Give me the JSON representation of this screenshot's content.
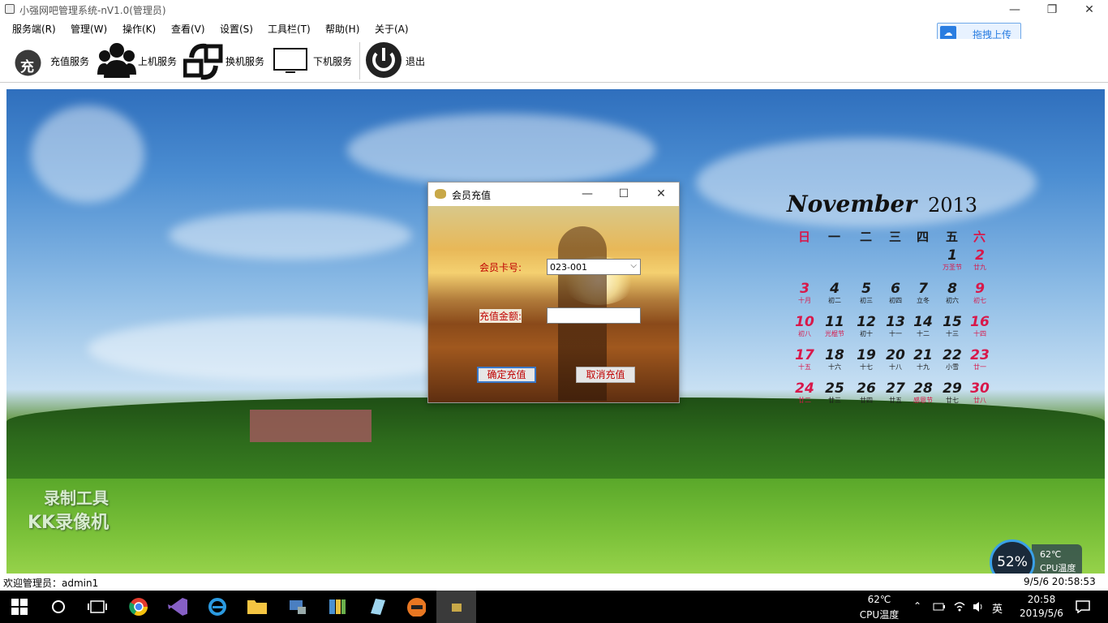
{
  "window": {
    "title": "小强网吧管理系统-nV1.0(管理员)"
  },
  "menu": [
    {
      "label": "服务端(R)"
    },
    {
      "label": "管理(W)"
    },
    {
      "label": "操作(K)"
    },
    {
      "label": "查看(V)"
    },
    {
      "label": "设置(S)"
    },
    {
      "label": "工具栏(T)"
    },
    {
      "label": "帮助(H)"
    },
    {
      "label": "关于(A)"
    }
  ],
  "upload": {
    "label": "拖拽上传"
  },
  "toolbar": {
    "recharge": {
      "label": "充值服务",
      "icon_text": "充"
    },
    "login": {
      "label": "上机服务"
    },
    "switch": {
      "label": "换机服务"
    },
    "logout": {
      "label": "下机服务"
    },
    "exit": {
      "label": "退出"
    }
  },
  "watermark": {
    "line1": "录制工具",
    "line2": "KK录像机"
  },
  "calendar": {
    "month": "November",
    "year": "2013",
    "weekdays": [
      "日",
      "一",
      "二",
      "三",
      "四",
      "五",
      "六"
    ],
    "days": [
      {
        "n": "1",
        "l": "万圣节",
        "col": 5,
        "row": 0
      },
      {
        "n": "2",
        "l": "廿九",
        "col": 6,
        "row": 0
      },
      {
        "n": "3",
        "l": "十月",
        "col": 0,
        "row": 1
      },
      {
        "n": "4",
        "l": "初二",
        "col": 1,
        "row": 1
      },
      {
        "n": "5",
        "l": "初三",
        "col": 2,
        "row": 1
      },
      {
        "n": "6",
        "l": "初四",
        "col": 3,
        "row": 1
      },
      {
        "n": "7",
        "l": "立冬",
        "col": 4,
        "row": 1
      },
      {
        "n": "8",
        "l": "初六",
        "col": 5,
        "row": 1
      },
      {
        "n": "9",
        "l": "初七",
        "col": 6,
        "row": 1
      },
      {
        "n": "10",
        "l": "初八",
        "col": 0,
        "row": 2
      },
      {
        "n": "11",
        "l": "光棍节",
        "col": 1,
        "row": 2
      },
      {
        "n": "12",
        "l": "初十",
        "col": 2,
        "row": 2
      },
      {
        "n": "13",
        "l": "十一",
        "col": 3,
        "row": 2
      },
      {
        "n": "14",
        "l": "十二",
        "col": 4,
        "row": 2
      },
      {
        "n": "15",
        "l": "十三",
        "col": 5,
        "row": 2
      },
      {
        "n": "16",
        "l": "十四",
        "col": 6,
        "row": 2
      },
      {
        "n": "17",
        "l": "十五",
        "col": 0,
        "row": 3
      },
      {
        "n": "18",
        "l": "十六",
        "col": 1,
        "row": 3
      },
      {
        "n": "19",
        "l": "十七",
        "col": 2,
        "row": 3
      },
      {
        "n": "20",
        "l": "十八",
        "col": 3,
        "row": 3
      },
      {
        "n": "21",
        "l": "十九",
        "col": 4,
        "row": 3
      },
      {
        "n": "22",
        "l": "小雪",
        "col": 5,
        "row": 3
      },
      {
        "n": "23",
        "l": "廿一",
        "col": 6,
        "row": 3
      },
      {
        "n": "24",
        "l": "廿二",
        "col": 0,
        "row": 4
      },
      {
        "n": "25",
        "l": "廿三",
        "col": 1,
        "row": 4
      },
      {
        "n": "26",
        "l": "廿四",
        "col": 2,
        "row": 4
      },
      {
        "n": "27",
        "l": "廿五",
        "col": 3,
        "row": 4
      },
      {
        "n": "28",
        "l": "感恩节",
        "col": 4,
        "row": 4
      },
      {
        "n": "29",
        "l": "廿七",
        "col": 5,
        "row": 4
      },
      {
        "n": "30",
        "l": "廿八",
        "col": 6,
        "row": 4
      }
    ],
    "weekend_color": "#d8184a",
    "holiday_color": "#d8184a"
  },
  "dialog": {
    "title": "会员充值",
    "card_label": "会员卡号:",
    "card_value": "023-001",
    "amount_label": "充值金额:",
    "amount_value": "",
    "confirm_label": "确定充值",
    "cancel_label": "取消充值",
    "label_color": "#c00000"
  },
  "status": {
    "left": "欢迎管理员：admin1",
    "right": "9/5/6 20:58:53"
  },
  "cpu": {
    "percent": "52%",
    "temp": "62℃",
    "label": "CPU温度"
  },
  "taskbar": {
    "cpu_temp": "62℃",
    "cpu_label": "CPU温度",
    "ime": "英",
    "time": "20:58",
    "date": "2019/5/6"
  }
}
